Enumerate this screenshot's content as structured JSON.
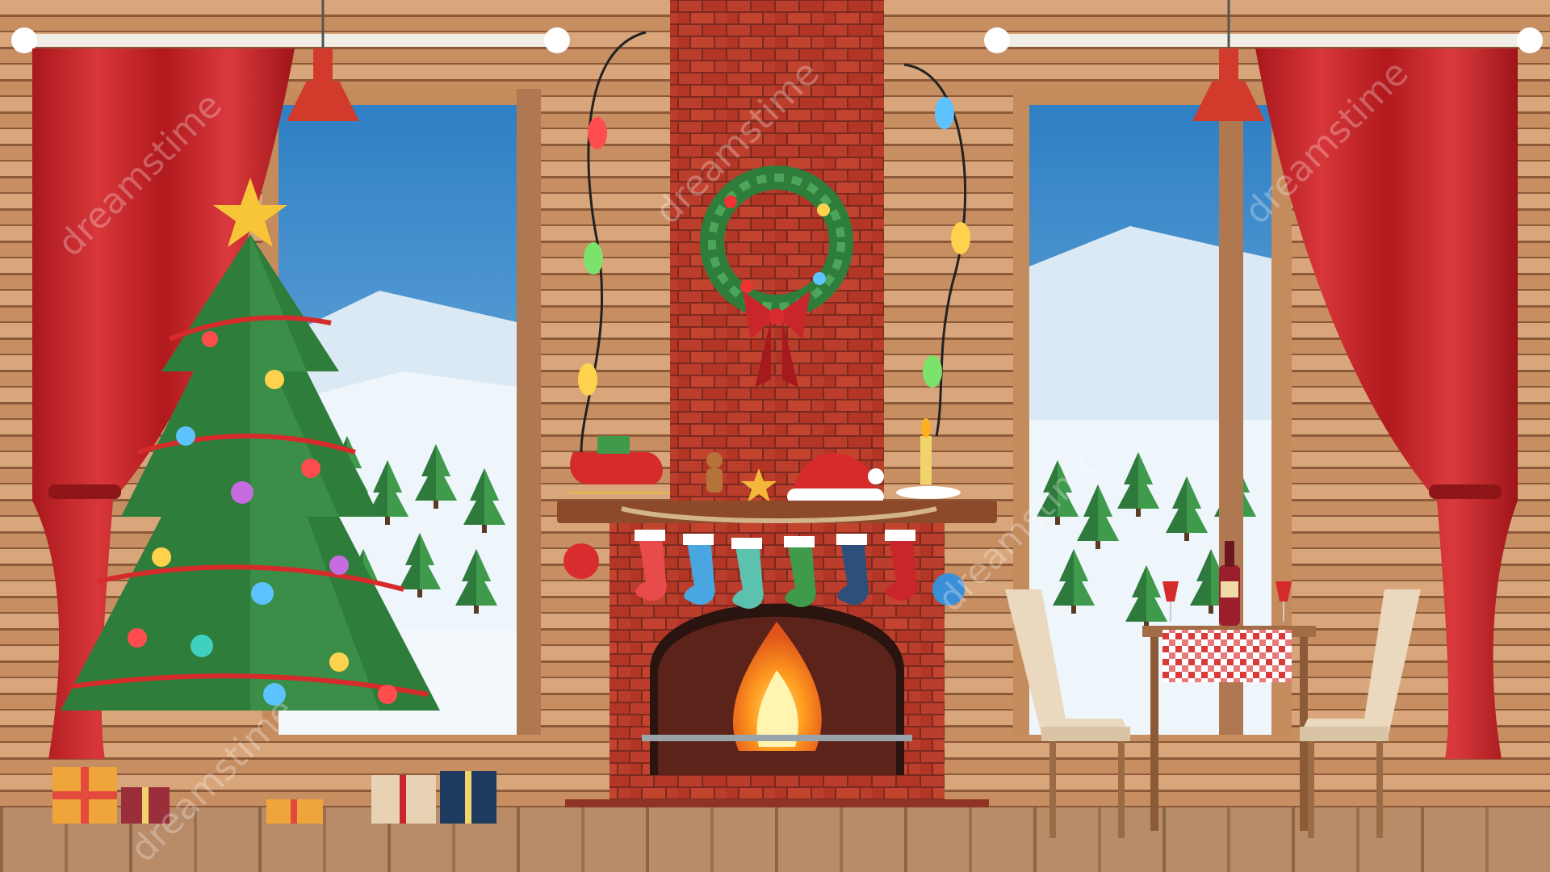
{
  "scene": {
    "watermark_text": "dreamstime",
    "colors": {
      "wall_light": "#d4a37a",
      "wall_dark": "#a56f49",
      "curtain": "#c8262a",
      "curtain_dark": "#8e1518",
      "brick": "#b83a2b",
      "floor": "#b08565",
      "sky": "#3f8fd0",
      "snow": "#eef6fb",
      "tree_green": "#2f7d3a",
      "fire": "#ffb020"
    },
    "icons": {
      "tree": "christmas-tree-icon",
      "star": "star-icon",
      "wreath": "wreath-icon",
      "fire": "fire-icon",
      "stocking": "stocking-icon",
      "gift": "gift-box-icon",
      "chair": "chair-icon",
      "table": "table-icon",
      "bottle": "wine-bottle-icon",
      "lamp": "pendant-lamp-icon",
      "sleigh": "sleigh-icon",
      "santa_hat": "santa-hat-icon",
      "candle": "candle-icon",
      "gingerbread": "gingerbread-man-icon"
    }
  }
}
